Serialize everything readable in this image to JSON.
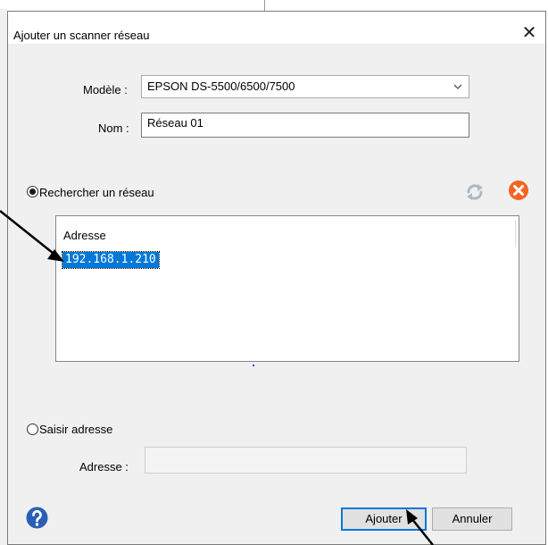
{
  "dialog": {
    "title": "Ajouter un scanner réseau",
    "close_glyph": "✕"
  },
  "form": {
    "model_label": "Modèle :",
    "model_value": "EPSON DS-5500/6500/7500",
    "name_label": "Nom :",
    "name_value": "Réseau 01"
  },
  "search": {
    "radio_label": "Rechercher un réseau",
    "selected": true,
    "list": {
      "column_header": "Adresse",
      "rows": [
        "192.168.1.210"
      ],
      "selected_index": 0
    }
  },
  "manual": {
    "radio_label": "Saisir adresse",
    "selected": false,
    "address_label": "Adresse :",
    "address_value": ""
  },
  "buttons": {
    "add_label": "Ajouter",
    "cancel_label": "Annuler"
  },
  "icons": {
    "refresh": "refresh-icon",
    "stop": "stop-icon",
    "help": "help-icon"
  },
  "colors": {
    "accent": "#0078d7",
    "stop": "#f26522",
    "help": "#2b5fb4",
    "refresh": "#a9b9c9"
  }
}
